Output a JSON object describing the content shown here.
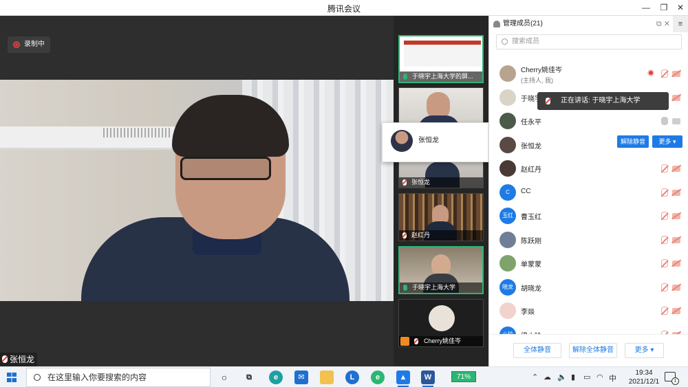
{
  "window": {
    "title": "腾讯会议",
    "minimize": "—",
    "maximize": "❐",
    "close": "✕"
  },
  "recording": {
    "label": "录制中"
  },
  "main_video": {
    "speaker_name": "张恒龙"
  },
  "thumbnails": [
    {
      "label": "于晓宇上海大学的屏...",
      "type": "screen",
      "mic": "on"
    },
    {
      "label": "",
      "type": "camera",
      "mic": "none"
    },
    {
      "label": "张恒龙",
      "type": "camera",
      "mic": "muted"
    },
    {
      "label": "赵红丹",
      "type": "camera",
      "mic": "muted"
    },
    {
      "label": "于晓宇上海大学",
      "type": "camera",
      "mic": "on"
    },
    {
      "label": "Cherry姚佳岑",
      "type": "avatar",
      "mic": "muted"
    }
  ],
  "hover_card": {
    "name": "张恒龙"
  },
  "panel": {
    "title": "管理成员(21)",
    "search_placeholder": "搜索成员",
    "menu_icon": "≡",
    "members": [
      {
        "name": "Cherry姚佳岑",
        "sub": "(主持人, 我)",
        "avatar_text": "",
        "avatar_color": "#b8a48e",
        "status": "host"
      },
      {
        "name": "于晓宇",
        "sub": "",
        "avatar_text": "",
        "avatar_color": "#d9d3c8",
        "status": "speaking"
      },
      {
        "name": "任永平",
        "sub": "",
        "avatar_text": "",
        "avatar_color": "#4c5a4a",
        "status": "gray"
      },
      {
        "name": "张恒龙",
        "sub": "",
        "avatar_text": "",
        "avatar_color": "#5a4a44",
        "status": "hover"
      },
      {
        "name": "赵红丹",
        "sub": "",
        "avatar_text": "",
        "avatar_color": "#4a3a36",
        "status": "muted"
      },
      {
        "name": "CC",
        "sub": "",
        "avatar_text": "C",
        "avatar_color": "#1e7be6",
        "status": "muted"
      },
      {
        "name": "曹玉红",
        "sub": "",
        "avatar_text": "玉红",
        "avatar_color": "#1e7be6",
        "status": "muted"
      },
      {
        "name": "陈跃刚",
        "sub": "",
        "avatar_text": "",
        "avatar_color": "#6f7f96",
        "status": "muted"
      },
      {
        "name": "单蒙蒙",
        "sub": "",
        "avatar_text": "",
        "avatar_color": "#7fa36b",
        "status": "muted"
      },
      {
        "name": "胡晓龙",
        "sub": "",
        "avatar_text": "晓龙",
        "avatar_color": "#1e7be6",
        "status": "muted"
      },
      {
        "name": "李燚",
        "sub": "",
        "avatar_text": "",
        "avatar_color": "#f2d2cc",
        "status": "muted"
      },
      {
        "name": "梁小玲",
        "sub": "",
        "avatar_text": "小玲",
        "avatar_color": "#1e7be6",
        "status": "muted"
      }
    ],
    "unmute_btn": "解除静音",
    "more_btn": "更多 ▾",
    "tooltip": "正在讲话: 于晓宇上海大学",
    "footer": {
      "mute_all": "全体静音",
      "unmute_all": "解除全体静音",
      "more": "更多 ▾"
    }
  },
  "taskbar": {
    "search_placeholder": "在这里输入你要搜索的内容",
    "battery": "71%",
    "ime": "中",
    "time": "19:34",
    "date": "2021/12/1",
    "notification_count": "1"
  }
}
